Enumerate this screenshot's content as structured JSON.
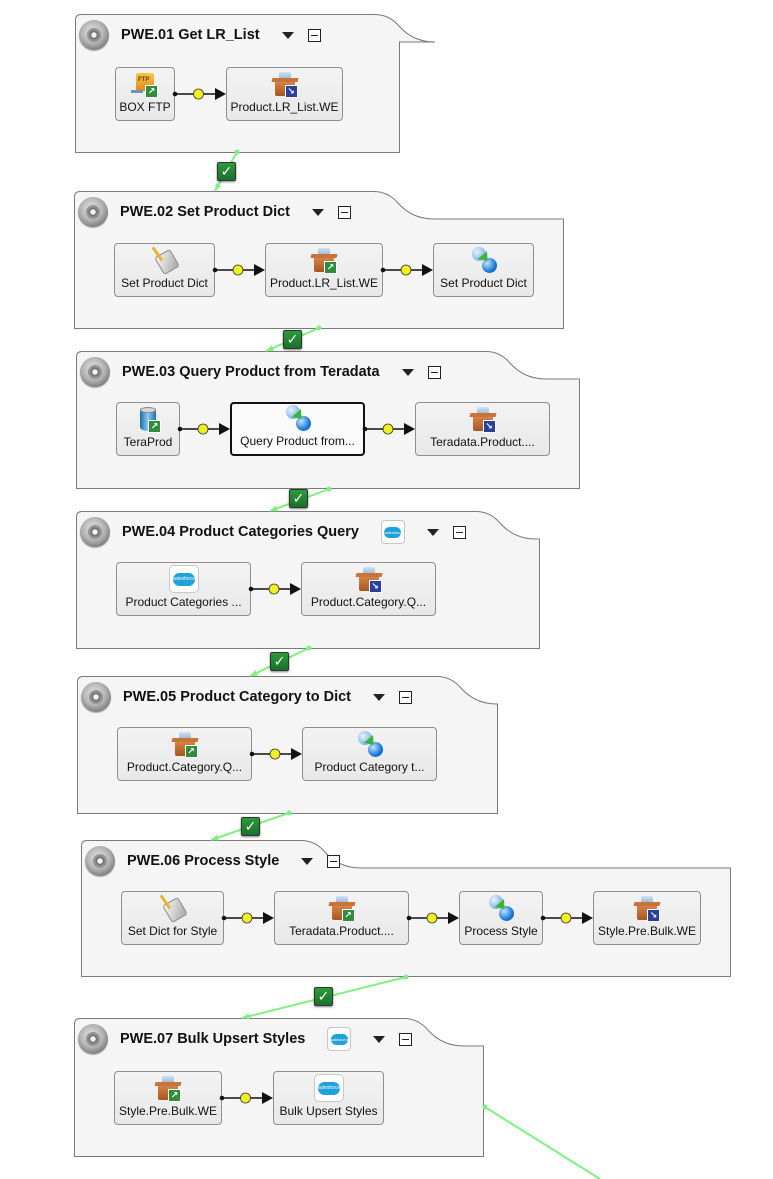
{
  "diagram": {
    "groups": [
      {
        "id": "pwe01",
        "title": "PWE.01 Get LR_List",
        "has_salesforce_badge": false,
        "nodes": [
          {
            "label": "BOX FTP",
            "icon": "ftp-source-icon"
          },
          {
            "label": "Product.LR_List.WE",
            "icon": "workspace-extract-icon"
          }
        ]
      },
      {
        "id": "pwe02",
        "title": "PWE.02 Set Product Dict",
        "has_salesforce_badge": false,
        "nodes": [
          {
            "label": "Set Product Dict",
            "icon": "script-icon"
          },
          {
            "label": "Product.LR_List.WE",
            "icon": "workspace-load-icon"
          },
          {
            "label": "Set Product Dict",
            "icon": "transform-icon"
          }
        ]
      },
      {
        "id": "pwe03",
        "title": "PWE.03 Query Product from Teradata",
        "has_salesforce_badge": false,
        "nodes": [
          {
            "label": "TeraProd",
            "icon": "database-icon"
          },
          {
            "label": "Query Product from...",
            "icon": "transform-icon",
            "selected": true
          },
          {
            "label": "Teradata.Product....",
            "icon": "workspace-extract-icon"
          }
        ]
      },
      {
        "id": "pwe04",
        "title": "PWE.04 Product Categories Query",
        "has_salesforce_badge": true,
        "nodes": [
          {
            "label": "Product Categories ...",
            "icon": "salesforce-icon"
          },
          {
            "label": "Product.Category.Q...",
            "icon": "workspace-extract-icon"
          }
        ]
      },
      {
        "id": "pwe05",
        "title": "PWE.05 Product Category to Dict",
        "has_salesforce_badge": false,
        "nodes": [
          {
            "label": "Product.Category.Q...",
            "icon": "workspace-load-icon"
          },
          {
            "label": "Product Category t...",
            "icon": "transform-icon"
          }
        ]
      },
      {
        "id": "pwe06",
        "title": "PWE.06 Process Style",
        "has_salesforce_badge": false,
        "nodes": [
          {
            "label": "Set Dict for Style",
            "icon": "script-icon"
          },
          {
            "label": "Teradata.Product....",
            "icon": "workspace-load-icon"
          },
          {
            "label": "Process Style",
            "icon": "transform-icon"
          },
          {
            "label": "Style.Pre.Bulk.WE",
            "icon": "workspace-extract-icon"
          }
        ]
      },
      {
        "id": "pwe07",
        "title": "PWE.07 Bulk Upsert Styles",
        "has_salesforce_badge": true,
        "nodes": [
          {
            "label": "Style.Pre.Bulk.WE",
            "icon": "workspace-load-icon"
          },
          {
            "label": "Bulk Upsert Styles",
            "icon": "salesforce-icon"
          }
        ]
      }
    ],
    "salesforce_text": "salesforce",
    "ftp_text": "FTP",
    "check_glyph": "✓",
    "in_glyph": "↗",
    "out_glyph": "↘",
    "colors": {
      "group_fill": "#f5f5f5",
      "group_border": "#7a7a7a",
      "success_link": "#7ff07f",
      "link_dot": "#f0f020",
      "check_green": "#23873a"
    }
  }
}
